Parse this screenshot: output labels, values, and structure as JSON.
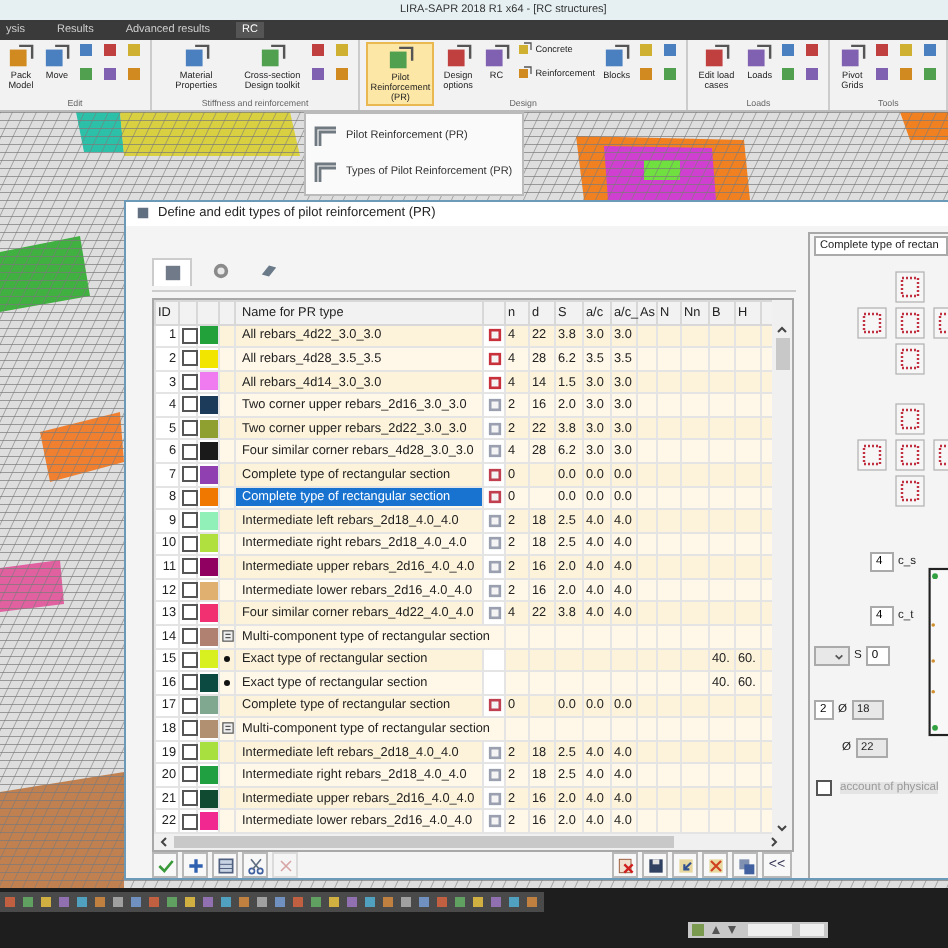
{
  "window": {
    "title": "LIRA-SAPR 2018 R1 x64 - [RC structures]"
  },
  "menu": [
    {
      "label": "ysis",
      "selected": false
    },
    {
      "label": "Results",
      "selected": false
    },
    {
      "label": "Advanced results",
      "selected": false
    },
    {
      "label": "RC",
      "selected": true
    }
  ],
  "ribbon": [
    {
      "label": "Edit",
      "items": [
        {
          "label": "Pack Model",
          "kind": "large",
          "expanded": false
        },
        {
          "label": "Move",
          "kind": "large",
          "expanded": false
        }
      ]
    },
    {
      "label": "Stiffness and reinforcement",
      "items": [
        {
          "label": "Material Properties",
          "kind": "large",
          "expanded": false
        },
        {
          "label": "Cross-section Design toolkit",
          "kind": "large",
          "expanded": false
        }
      ]
    },
    {
      "label": "Design",
      "items": [
        {
          "label": "Pilot Reinforcement (PR)",
          "kind": "large",
          "expanded": true
        },
        {
          "label": "Design options",
          "kind": "large",
          "expanded": false
        },
        {
          "label": "RC",
          "kind": "large",
          "expanded": false
        },
        {
          "label": "Concrete",
          "kind": "small",
          "expanded": false
        },
        {
          "label": "Reinforcement",
          "kind": "small",
          "expanded": false
        },
        {
          "label": "Blocks",
          "kind": "large",
          "expanded": false
        }
      ]
    },
    {
      "label": "Loads",
      "items": [
        {
          "label": "Edit load cases",
          "kind": "large",
          "expanded": false
        },
        {
          "label": "Loads",
          "kind": "large",
          "expanded": false
        }
      ]
    },
    {
      "label": "Tools",
      "items": [
        {
          "label": "Pivot Grids",
          "kind": "large",
          "expanded": false
        }
      ]
    }
  ],
  "dropdown": {
    "items": [
      {
        "label": "Pilot Reinforcement (PR)"
      },
      {
        "label": "Types of Pilot Reinforcement (PR)"
      }
    ]
  },
  "dialog": {
    "title": "Define and edit types of pilot reinforcement (PR)",
    "tabs": [
      {
        "selected": true
      },
      {
        "selected": false
      },
      {
        "selected": false
      }
    ],
    "table": {
      "id_header": "ID",
      "name_header": "Name for PR type",
      "columns": [
        "n",
        "d",
        "S",
        "a/c",
        "a/c_",
        "As",
        "N",
        "Nn",
        "B",
        "H"
      ],
      "rows": [
        {
          "id": "1",
          "checked": false,
          "color": "#22a03a",
          "kind": "all",
          "name": "All rebars_4d22_3.0_3.0",
          "selected": false,
          "cells": [
            "4",
            "22",
            "3.8",
            "3.0",
            "3.0"
          ]
        },
        {
          "id": "2",
          "checked": false,
          "color": "#f2e600",
          "kind": "all",
          "name": "All rebars_4d28_3.5_3.5",
          "selected": false,
          "cells": [
            "4",
            "28",
            "6.2",
            "3.5",
            "3.5"
          ]
        },
        {
          "id": "3",
          "checked": false,
          "color": "#f07af0",
          "kind": "all",
          "name": "All rebars_4d14_3.0_3.0",
          "selected": false,
          "cells": [
            "4",
            "14",
            "1.5",
            "3.0",
            "3.0"
          ]
        },
        {
          "id": "4",
          "checked": false,
          "color": "#1c3a5a",
          "kind": "corner",
          "name": "Two corner upper rebars_2d16_3.0_3.0",
          "selected": false,
          "cells": [
            "2",
            "16",
            "2.0",
            "3.0",
            "3.0"
          ]
        },
        {
          "id": "5",
          "checked": false,
          "color": "#8fa030",
          "kind": "corner",
          "name": "Two corner upper rebars_2d22_3.0_3.0",
          "selected": false,
          "cells": [
            "2",
            "22",
            "3.8",
            "3.0",
            "3.0"
          ]
        },
        {
          "id": "6",
          "checked": false,
          "color": "#1a1a1a",
          "kind": "corner",
          "name": "Four similar corner rebars_4d28_3.0_3.0",
          "selected": false,
          "cells": [
            "4",
            "28",
            "6.2",
            "3.0",
            "3.0"
          ]
        },
        {
          "id": "7",
          "checked": false,
          "color": "#9040b0",
          "kind": "complete",
          "name": "Complete type of rectangular section",
          "selected": false,
          "cells": [
            "0",
            null,
            "0.0",
            "0.0",
            "0.0"
          ]
        },
        {
          "id": "8",
          "checked": false,
          "color": "#f07800",
          "kind": "complete",
          "name": "Complete type of rectangular section",
          "selected": true,
          "cells": [
            "0",
            null,
            "0.0",
            "0.0",
            "0.0"
          ]
        },
        {
          "id": "9",
          "checked": false,
          "color": "#90f0b8",
          "kind": "intermediate",
          "name": "Intermediate left rebars_2d18_4.0_4.0",
          "selected": false,
          "cells": [
            "2",
            "18",
            "2.5",
            "4.0",
            "4.0"
          ]
        },
        {
          "id": "10",
          "checked": false,
          "color": "#b0e040",
          "kind": "intermediate",
          "name": "Intermediate right rebars_2d18_4.0_4.0",
          "selected": false,
          "cells": [
            "2",
            "18",
            "2.5",
            "4.0",
            "4.0"
          ]
        },
        {
          "id": "11",
          "checked": false,
          "color": "#900060",
          "kind": "intermediate",
          "name": "Intermediate upper rebars_2d16_4.0_4.0",
          "selected": false,
          "cells": [
            "2",
            "16",
            "2.0",
            "4.0",
            "4.0"
          ]
        },
        {
          "id": "12",
          "checked": false,
          "color": "#e0b070",
          "kind": "intermediate",
          "name": "Intermediate lower rebars_2d16_4.0_4.0",
          "selected": false,
          "cells": [
            "2",
            "16",
            "2.0",
            "4.0",
            "4.0"
          ]
        },
        {
          "id": "13",
          "checked": false,
          "color": "#f03070",
          "kind": "corner",
          "name": "Four similar corner rebars_4d22_4.0_4.0",
          "selected": false,
          "cells": [
            "4",
            "22",
            "3.8",
            "4.0",
            "4.0"
          ]
        },
        {
          "id": "14",
          "checked": false,
          "color": "#b08070",
          "kind": "multi",
          "name": "Multi-component type of rectangular section",
          "selected": false
        },
        {
          "id": "15",
          "checked": false,
          "color": "#d8f020",
          "kind": "exact",
          "name": "Exact type of rectangular section",
          "selected": false,
          "cells": [
            null,
            null,
            null,
            null,
            null,
            null,
            null,
            null,
            "40.",
            "60."
          ]
        },
        {
          "id": "16",
          "checked": false,
          "color": "#0a4a40",
          "kind": "exact",
          "name": "Exact type of rectangular section",
          "selected": false,
          "cells": [
            null,
            null,
            null,
            null,
            null,
            null,
            null,
            null,
            "40.",
            "60."
          ]
        },
        {
          "id": "17",
          "checked": false,
          "color": "#80a890",
          "kind": "complete",
          "name": "Complete type of rectangular section",
          "selected": false,
          "cells": [
            "0",
            null,
            "0.0",
            "0.0",
            "0.0"
          ]
        },
        {
          "id": "18",
          "checked": false,
          "color": "#b09070",
          "kind": "multi",
          "name": "Multi-component type of rectangular section",
          "selected": false
        },
        {
          "id": "19",
          "checked": false,
          "color": "#a8e040",
          "kind": "intermediate",
          "name": "Intermediate left rebars_2d18_4.0_4.0",
          "selected": false,
          "cells": [
            "2",
            "18",
            "2.5",
            "4.0",
            "4.0"
          ]
        },
        {
          "id": "20",
          "checked": false,
          "color": "#20a040",
          "kind": "intermediate",
          "name": "Intermediate right rebars_2d18_4.0_4.0",
          "selected": false,
          "cells": [
            "2",
            "18",
            "2.5",
            "4.0",
            "4.0"
          ]
        },
        {
          "id": "21",
          "checked": false,
          "color": "#104a30",
          "kind": "intermediate",
          "name": "Intermediate upper rebars_2d16_4.0_4.0",
          "selected": false,
          "cells": [
            "2",
            "16",
            "2.0",
            "4.0",
            "4.0"
          ]
        },
        {
          "id": "22",
          "checked": false,
          "color": "#f02890",
          "kind": "intermediate",
          "name": "Intermediate lower rebars_2d16_4.0_4.0",
          "selected": false,
          "cells": [
            "2",
            "16",
            "2.0",
            "4.0",
            "4.0"
          ]
        }
      ]
    },
    "left_tools": [
      {
        "disabled": false
      },
      {
        "disabled": false
      },
      {
        "disabled": false
      },
      {
        "disabled": false
      },
      {
        "disabled": true
      }
    ],
    "collapse_button": "<<",
    "panel": {
      "combo": "Complete type of rectan",
      "cover_top": {
        "value": "4",
        "label": "c_s"
      },
      "cover_side": {
        "value": "4",
        "label": "c_t"
      },
      "spacing": {
        "label": "S",
        "value": "0"
      },
      "side_bars": {
        "count": "2",
        "symbol": "Ø",
        "diameter": "18"
      },
      "corner_bars": {
        "symbol": "Ø",
        "diameter": "22"
      },
      "physical": {
        "label": "account of physical",
        "checked": false,
        "disabled": true
      }
    }
  }
}
